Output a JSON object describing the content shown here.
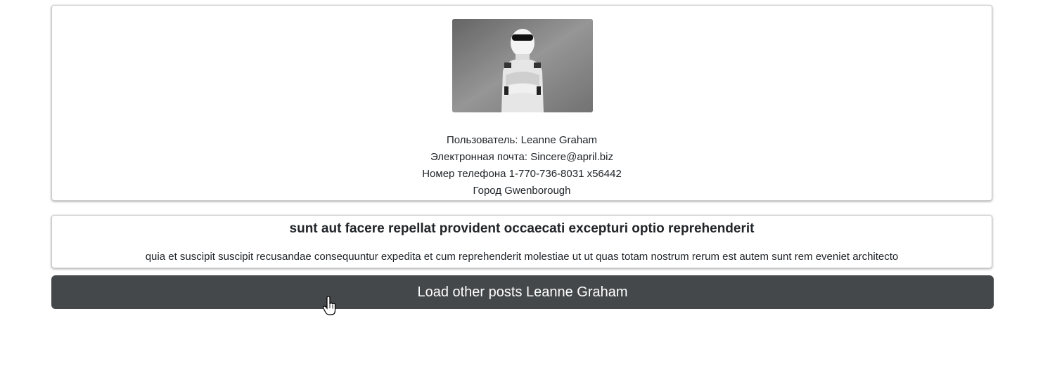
{
  "user": {
    "photo_alt": "helmeted driver photo",
    "name_line": "Пользователь: Leanne Graham",
    "email_line": "Электронная почта: Sincere@april.biz",
    "phone_line": "Номер телефона 1-770-736-8031 x56442",
    "city_line": "Город Gwenborough"
  },
  "post": {
    "title": "sunt aut facere repellat provident occaecati excepturi optio reprehenderit",
    "body": "quia et suscipit suscipit recusandae consequuntur expedita et cum reprehenderit molestiae ut ut quas totam nostrum rerum est autem sunt rem eveniet architecto"
  },
  "actions": {
    "load_more_label": "Load other posts Leanne Graham"
  },
  "icons": {
    "cursor": "hand-pointer-icon"
  }
}
